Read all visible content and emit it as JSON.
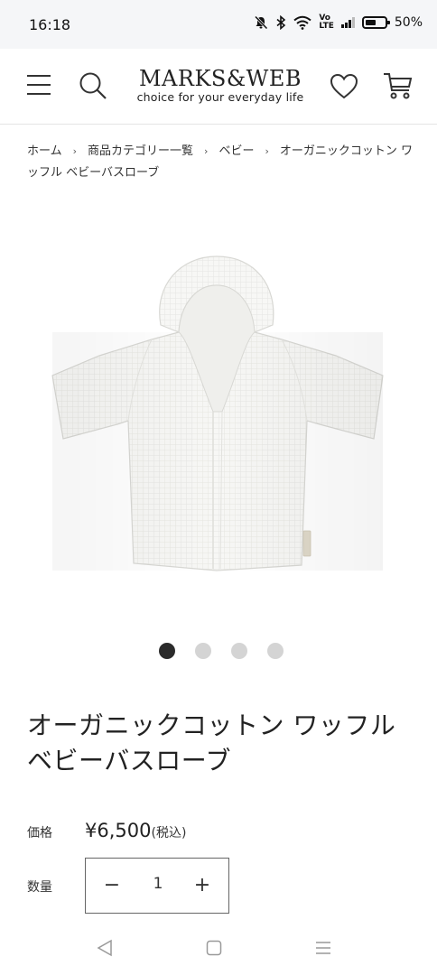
{
  "status_bar": {
    "time": "16:18",
    "battery": "50%",
    "icons": [
      "mute-icon",
      "bluetooth-icon",
      "wifi-icon",
      "volte-icon",
      "signal-icon",
      "battery-icon"
    ]
  },
  "header": {
    "brand": "MARKS&WEB",
    "tagline": "choice for your everyday life"
  },
  "breadcrumb": {
    "items": [
      "ホーム",
      "商品カテゴリー一覧",
      "ベビー",
      "オーガニックコットン ワッフル ベビーバスローブ"
    ],
    "separator": "›"
  },
  "carousel": {
    "total": 4,
    "active": 1
  },
  "product": {
    "title": "オーガニックコットン ワッフル ベビーバスローブ",
    "price_label": "価格",
    "price": "¥6,500",
    "tax_note": "(税込)",
    "quantity_label": "数量",
    "quantity": "1",
    "minus": "−",
    "plus": "+"
  },
  "colors": {
    "status_bg": "#f5f6f8",
    "text": "#222222",
    "dot_active": "#2b2b2b",
    "dot_inactive": "#d4d4d4"
  }
}
